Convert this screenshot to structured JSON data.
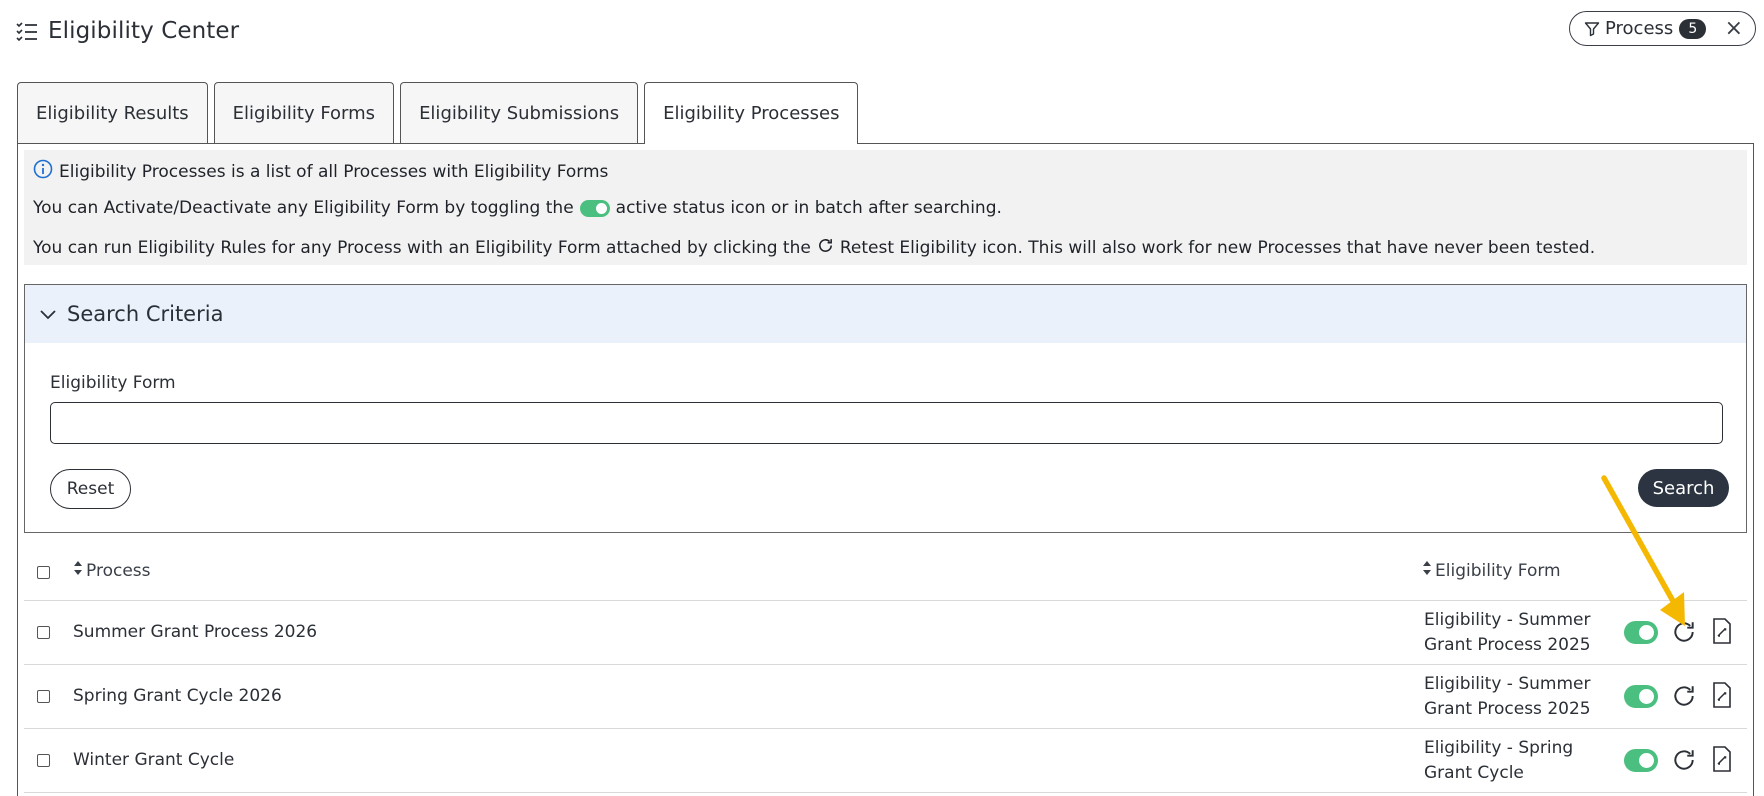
{
  "header": {
    "title": "Eligibility Center",
    "icon": "list-check-icon"
  },
  "filter": {
    "label": "Process",
    "count": "5",
    "close": "×"
  },
  "tabs": [
    {
      "label": "Eligibility Results",
      "active": false
    },
    {
      "label": "Eligibility Forms",
      "active": false
    },
    {
      "label": "Eligibility Submissions",
      "active": false
    },
    {
      "label": "Eligibility Processes",
      "active": true
    }
  ],
  "info": {
    "line1": "Eligibility Processes is a list of all Processes with Eligibility Forms",
    "line2_pre": "You can Activate/Deactivate any Eligibility Form by toggling the",
    "line2_post": "active status icon or in batch after searching.",
    "line3_pre": "You can run Eligibility Rules for any Process with an Eligibility Form attached by clicking the",
    "line3_post": "Retest Eligibility icon. This will also work for new Processes that have never been tested."
  },
  "search": {
    "title": "Search Criteria",
    "field_label": "Eligibility Form",
    "field_value": "",
    "reset_label": "Reset",
    "search_label": "Search"
  },
  "table": {
    "col_process": "Process",
    "col_form": "Eligibility Form",
    "rows": [
      {
        "process": "Summer Grant Process 2026",
        "form": "Eligibility - Summer Grant Process 2025",
        "active": true
      },
      {
        "process": "Spring Grant Cycle 2026",
        "form": "Eligibility - Summer Grant Process 2025",
        "active": true
      },
      {
        "process": "Winter Grant Cycle",
        "form": "Eligibility - Spring Grant Cycle",
        "active": true
      }
    ]
  },
  "colors": {
    "toggle_on": "#4bbf7f",
    "annotation_arrow": "#f5b800",
    "search_header_bg": "#eaf1fb"
  }
}
